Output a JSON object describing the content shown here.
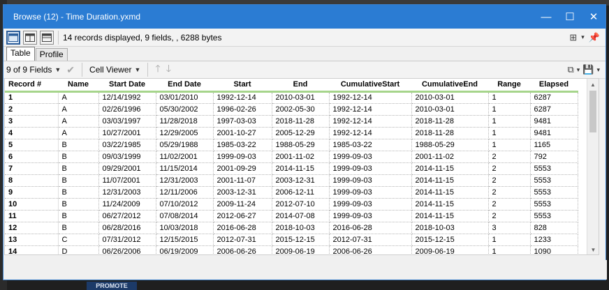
{
  "window": {
    "title": "Browse (12) - Time Duration.yxmd",
    "controls": {
      "minimize": "—",
      "maximize": "☐",
      "close": "✕"
    }
  },
  "toolbar": {
    "records_info": "14 records displayed, 9 fields, , 6288 bytes"
  },
  "tabs": [
    {
      "label": "Table",
      "active": true
    },
    {
      "label": "Profile",
      "active": false
    }
  ],
  "toolbar2": {
    "fields_selector": "9 of 9 Fields",
    "cell_viewer": "Cell Viewer"
  },
  "grid": {
    "columns": [
      "Record #",
      "Name",
      "Start Date",
      "End Date",
      "Start",
      "End",
      "CumulativeStart",
      "CumulativeEnd",
      "Range",
      "Elapsed"
    ],
    "rows": [
      [
        "1",
        "A",
        "12/14/1992",
        "03/01/2010",
        "1992-12-14",
        "2010-03-01",
        "1992-12-14",
        "2010-03-01",
        "1",
        "6287"
      ],
      [
        "2",
        "A",
        "02/26/1996",
        "05/30/2002",
        "1996-02-26",
        "2002-05-30",
        "1992-12-14",
        "2010-03-01",
        "1",
        "6287"
      ],
      [
        "3",
        "A",
        "03/03/1997",
        "11/28/2018",
        "1997-03-03",
        "2018-11-28",
        "1992-12-14",
        "2018-11-28",
        "1",
        "9481"
      ],
      [
        "4",
        "A",
        "10/27/2001",
        "12/29/2005",
        "2001-10-27",
        "2005-12-29",
        "1992-12-14",
        "2018-11-28",
        "1",
        "9481"
      ],
      [
        "5",
        "B",
        "03/22/1985",
        "05/29/1988",
        "1985-03-22",
        "1988-05-29",
        "1985-03-22",
        "1988-05-29",
        "1",
        "1165"
      ],
      [
        "6",
        "B",
        "09/03/1999",
        "11/02/2001",
        "1999-09-03",
        "2001-11-02",
        "1999-09-03",
        "2001-11-02",
        "2",
        "792"
      ],
      [
        "7",
        "B",
        "09/29/2001",
        "11/15/2014",
        "2001-09-29",
        "2014-11-15",
        "1999-09-03",
        "2014-11-15",
        "2",
        "5553"
      ],
      [
        "8",
        "B",
        "11/07/2001",
        "12/31/2003",
        "2001-11-07",
        "2003-12-31",
        "1999-09-03",
        "2014-11-15",
        "2",
        "5553"
      ],
      [
        "9",
        "B",
        "12/31/2003",
        "12/11/2006",
        "2003-12-31",
        "2006-12-11",
        "1999-09-03",
        "2014-11-15",
        "2",
        "5553"
      ],
      [
        "10",
        "B",
        "11/24/2009",
        "07/10/2012",
        "2009-11-24",
        "2012-07-10",
        "1999-09-03",
        "2014-11-15",
        "2",
        "5553"
      ],
      [
        "11",
        "B",
        "06/27/2012",
        "07/08/2014",
        "2012-06-27",
        "2014-07-08",
        "1999-09-03",
        "2014-11-15",
        "2",
        "5553"
      ],
      [
        "12",
        "B",
        "06/28/2016",
        "10/03/2018",
        "2016-06-28",
        "2018-10-03",
        "2016-06-28",
        "2018-10-03",
        "3",
        "828"
      ],
      [
        "13",
        "C",
        "07/31/2012",
        "12/15/2015",
        "2012-07-31",
        "2015-12-15",
        "2012-07-31",
        "2015-12-15",
        "1",
        "1233"
      ],
      [
        "14",
        "D",
        "06/26/2006",
        "06/19/2009",
        "2006-06-26",
        "2009-06-19",
        "2006-06-26",
        "2009-06-19",
        "1",
        "1090"
      ]
    ]
  },
  "taskbar": {
    "promote_label": "PROMOTE"
  },
  "colors": {
    "titlebar": "#2b7cd3",
    "header_underline": "#a6d58b"
  }
}
